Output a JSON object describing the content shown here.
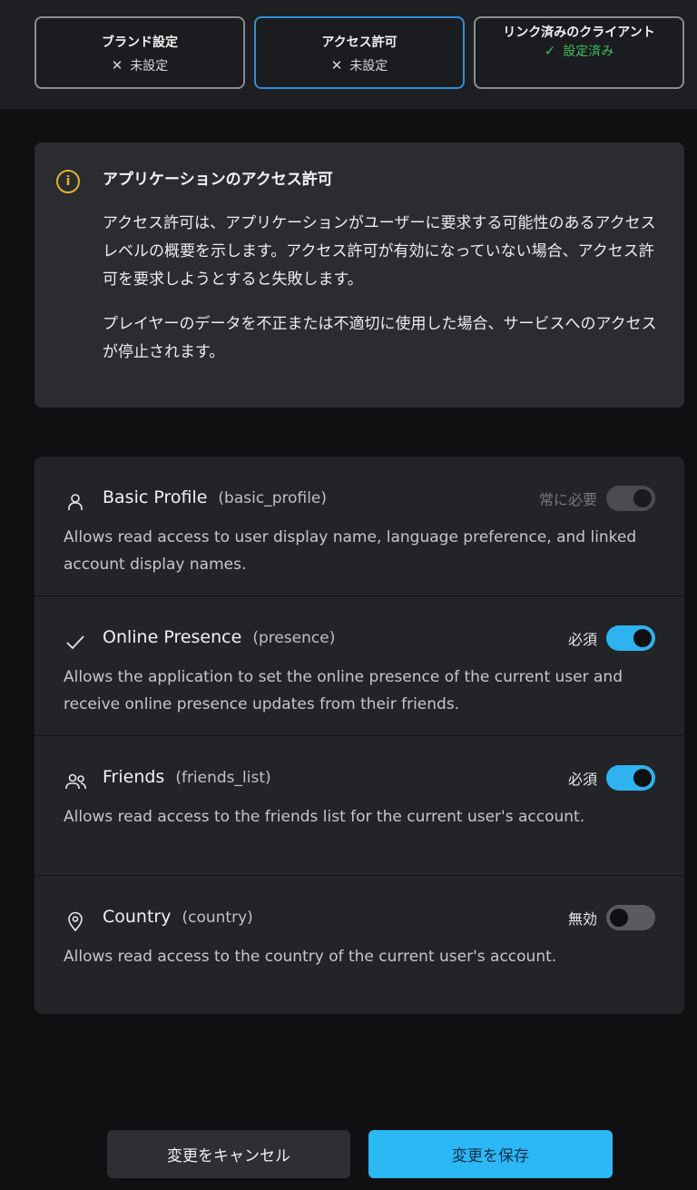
{
  "steps": [
    {
      "title": "ブランド設定",
      "status": "未設定",
      "status_icon": "x-icon",
      "state": "incomplete"
    },
    {
      "title": "アクセス許可",
      "status": "未設定",
      "status_icon": "x-icon",
      "state": "incomplete",
      "active": true
    },
    {
      "title": "リンク済みのクライアント",
      "status": "設定済み",
      "status_icon": "check-icon",
      "state": "complete"
    }
  ],
  "info": {
    "title": "アプリケーションのアクセス許可",
    "paragraph1": "アクセス許可は、アプリケーションがユーザーに要求する可能性のあるアクセスレベルの概要を示します。アクセス許可が有効になっていない場合、アクセス許可を要求しようとすると失敗します。",
    "paragraph2": "プレイヤーのデータを不正または不適切に使用した場合、サービスへのアクセスが停止されます。"
  },
  "permissions": [
    {
      "icon": "user-icon",
      "name": "Basic Profile",
      "scope": "(basic_profile)",
      "state_label": "常に必要",
      "toggle": "locked",
      "description": "Allows read access to user display name, language preference, and linked account display names."
    },
    {
      "icon": "check-icon",
      "name": "Online Presence",
      "scope": "(presence)",
      "state_label": "必須",
      "toggle": "on",
      "description": "Allows the application to set the online presence of the current user and receive online presence updates from their friends."
    },
    {
      "icon": "users-icon",
      "name": "Friends",
      "scope": "(friends_list)",
      "state_label": "必須",
      "toggle": "on",
      "description": "Allows read access to the friends list for the current user's account."
    },
    {
      "icon": "location-pin-icon",
      "name": "Country",
      "scope": "(country)",
      "state_label": "無効",
      "toggle": "off",
      "description": "Allows read access to the country of the current user's account."
    }
  ],
  "actions": {
    "cancel_label": "変更をキャンセル",
    "save_label": "変更を保存"
  },
  "colors": {
    "accent": "#2cb8f5",
    "success": "#3fbf5e",
    "warning": "#e0b330"
  }
}
